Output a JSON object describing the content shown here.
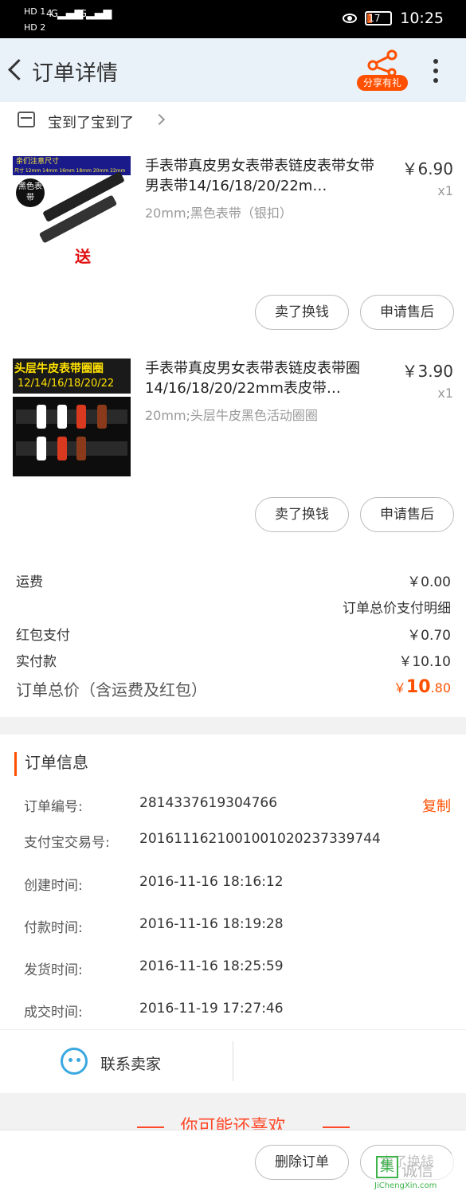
{
  "status_bar": {
    "sim1": "HD 1",
    "sim2": "HD 2",
    "net1": "4G",
    "net2": "4G",
    "battery": "17",
    "time": "10:25"
  },
  "nav": {
    "title": "订单详情",
    "share_label": "分享有礼"
  },
  "shop": {
    "name": "宝到了宝到了"
  },
  "items": [
    {
      "title": "手表带真皮男女表带表链皮表带女带男表带14/16/18/20/22m…",
      "spec": "20mm;黑色表带（银扣）",
      "price": "￥6.90",
      "qty": "x1",
      "thumb_banner": "亲们注意尺寸",
      "thumb_sizes": "尺寸 12mm 14mm 16mm 18mm 20mm 22mm",
      "thumb_badge": "黑色表带",
      "thumb_gift": "送",
      "btn_sell": "卖了换钱",
      "btn_after": "申请售后"
    },
    {
      "title": "手表带真皮男女表带表链皮表带圈14/16/18/20/22mm表皮带…",
      "spec": "20mm;头层牛皮黑色活动圈圈",
      "price": "￥3.90",
      "qty": "x1",
      "thumb_banner": "头层牛皮表带圈圈",
      "thumb_sizes": "12/14/16/18/20/22",
      "btn_sell": "卖了换钱",
      "btn_after": "申请售后"
    }
  ],
  "summary": {
    "shipping_label": "运费",
    "shipping_value": "￥0.00",
    "detail_link": "订单总价支付明细",
    "redpacket_label": "红包支付",
    "redpacket_value": "￥0.70",
    "paid_label": "实付款",
    "paid_value": "￥10.10",
    "total_label": "订单总价（含运费及红包）",
    "total_currency": "￥",
    "total_int": "10",
    "total_dec": ".80"
  },
  "order_info": {
    "heading": "订单信息",
    "rows": [
      {
        "key": "订单编号:",
        "value": "2814337619304766",
        "action": "复制"
      },
      {
        "key": "支付宝交易号:",
        "value": "2016111621001001020237339744"
      },
      {
        "key": "创建时间:",
        "value": "2016-11-16 18:16:12"
      },
      {
        "key": "付款时间:",
        "value": "2016-11-16 18:19:28"
      },
      {
        "key": "发货时间:",
        "value": "2016-11-16 18:25:59"
      },
      {
        "key": "成交时间:",
        "value": "2016-11-19 17:27:46"
      }
    ]
  },
  "contact": {
    "label": "联系卖家"
  },
  "recommend": {
    "label": "你可能还喜欢"
  },
  "bottom": {
    "delete_label": "删除订单",
    "sell_label": "卖了换钱"
  },
  "watermark": {
    "box": "集",
    "text": "诚信",
    "url": "JiChengXin.com"
  },
  "colors": {
    "accent": "#ff5000",
    "nav_bg": "#e9f1f9",
    "service": "#3aa8e0"
  }
}
